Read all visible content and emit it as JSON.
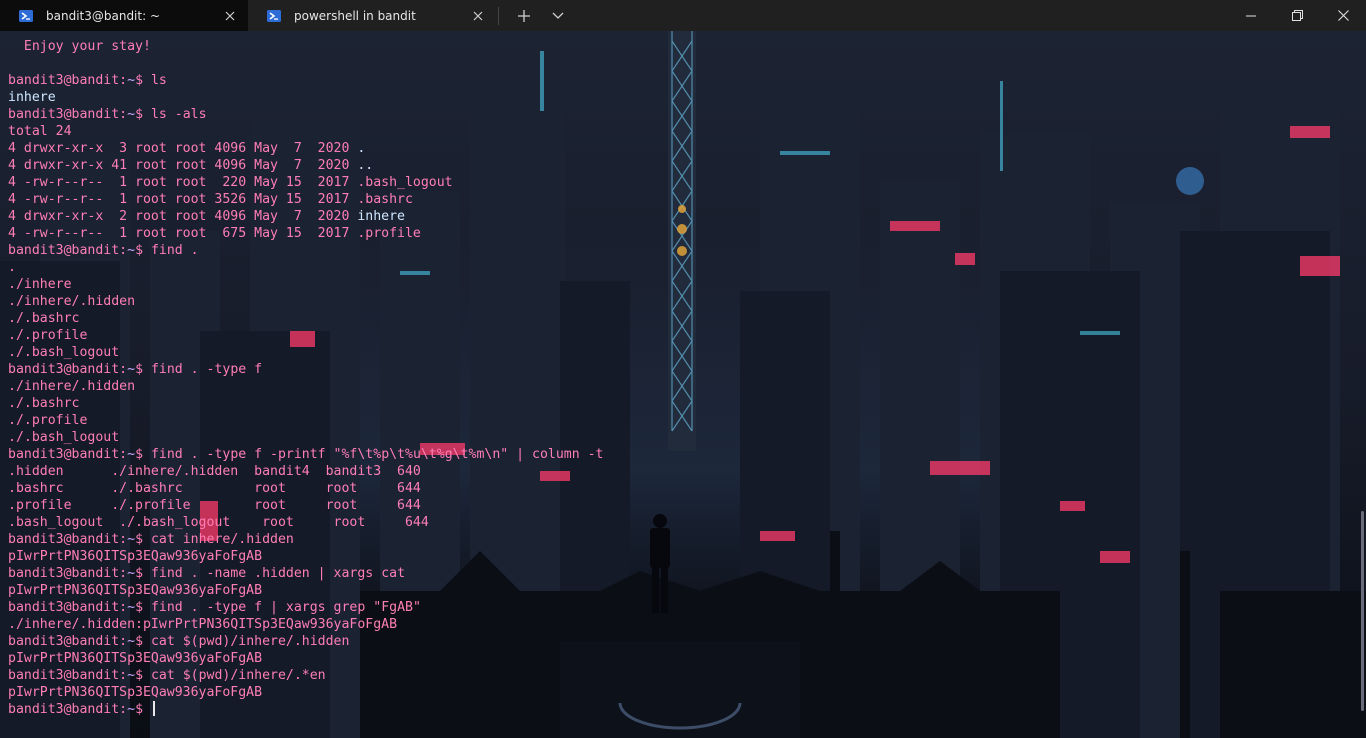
{
  "tabs": [
    {
      "title": "bandit3@bandit: ~",
      "icon": "powershell-icon",
      "active": true
    },
    {
      "title": "powershell in bandit",
      "icon": "powershell-icon",
      "active": false
    }
  ],
  "terminal": {
    "prompt_user": "bandit3@bandit",
    "prompt_path": "~",
    "lines": [
      {
        "segs": [
          {
            "t": "  Enjoy your stay!",
            "c": "out"
          }
        ]
      },
      {
        "segs": [
          {
            "t": "",
            "c": "out"
          }
        ]
      },
      {
        "segs": [
          {
            "t": "bandit3@bandit",
            "c": "prompt"
          },
          {
            "t": ":",
            "c": "colon"
          },
          {
            "t": "~",
            "c": "path"
          },
          {
            "t": "$ ls",
            "c": "prompt"
          }
        ]
      },
      {
        "segs": [
          {
            "t": "inhere",
            "c": "blue"
          }
        ]
      },
      {
        "segs": [
          {
            "t": "bandit3@bandit",
            "c": "prompt"
          },
          {
            "t": ":",
            "c": "colon"
          },
          {
            "t": "~",
            "c": "path"
          },
          {
            "t": "$ ls -als",
            "c": "prompt"
          }
        ]
      },
      {
        "segs": [
          {
            "t": "total 24",
            "c": "out"
          }
        ]
      },
      {
        "segs": [
          {
            "t": "4 drwxr-xr-x  3 root root 4096 May  7  2020 ",
            "c": "out"
          },
          {
            "t": ".",
            "c": "blue"
          }
        ]
      },
      {
        "segs": [
          {
            "t": "4 drwxr-xr-x 41 root root 4096 May  7  2020 ",
            "c": "out"
          },
          {
            "t": "..",
            "c": "blue"
          }
        ]
      },
      {
        "segs": [
          {
            "t": "4 -rw-r--r--  1 root root  220 May 15  2017 .bash_logout",
            "c": "out"
          }
        ]
      },
      {
        "segs": [
          {
            "t": "4 -rw-r--r--  1 root root 3526 May 15  2017 .bashrc",
            "c": "out"
          }
        ]
      },
      {
        "segs": [
          {
            "t": "4 drwxr-xr-x  2 root root 4096 May  7  2020 ",
            "c": "out"
          },
          {
            "t": "inhere",
            "c": "blue"
          }
        ]
      },
      {
        "segs": [
          {
            "t": "4 -rw-r--r--  1 root root  675 May 15  2017 .profile",
            "c": "out"
          }
        ]
      },
      {
        "segs": [
          {
            "t": "bandit3@bandit",
            "c": "prompt"
          },
          {
            "t": ":",
            "c": "colon"
          },
          {
            "t": "~",
            "c": "path"
          },
          {
            "t": "$ find .",
            "c": "prompt"
          }
        ]
      },
      {
        "segs": [
          {
            "t": ".",
            "c": "out"
          }
        ]
      },
      {
        "segs": [
          {
            "t": "./inhere",
            "c": "out"
          }
        ]
      },
      {
        "segs": [
          {
            "t": "./inhere/.hidden",
            "c": "out"
          }
        ]
      },
      {
        "segs": [
          {
            "t": "./.bashrc",
            "c": "out"
          }
        ]
      },
      {
        "segs": [
          {
            "t": "./.profile",
            "c": "out"
          }
        ]
      },
      {
        "segs": [
          {
            "t": "./.bash_logout",
            "c": "out"
          }
        ]
      },
      {
        "segs": [
          {
            "t": "bandit3@bandit",
            "c": "prompt"
          },
          {
            "t": ":",
            "c": "colon"
          },
          {
            "t": "~",
            "c": "path"
          },
          {
            "t": "$ find . -type f",
            "c": "prompt"
          }
        ]
      },
      {
        "segs": [
          {
            "t": "./inhere/.hidden",
            "c": "out"
          }
        ]
      },
      {
        "segs": [
          {
            "t": "./.bashrc",
            "c": "out"
          }
        ]
      },
      {
        "segs": [
          {
            "t": "./.profile",
            "c": "out"
          }
        ]
      },
      {
        "segs": [
          {
            "t": "./.bash_logout",
            "c": "out"
          }
        ]
      },
      {
        "segs": [
          {
            "t": "bandit3@bandit",
            "c": "prompt"
          },
          {
            "t": ":",
            "c": "colon"
          },
          {
            "t": "~",
            "c": "path"
          },
          {
            "t": "$ find . -type f -printf \"%f\\t%p\\t%u\\t%g\\t%m\\n\" | column -t",
            "c": "prompt"
          }
        ]
      },
      {
        "segs": [
          {
            "t": ".hidden      ./inhere/.hidden  bandit4  bandit3  640",
            "c": "out"
          }
        ]
      },
      {
        "segs": [
          {
            "t": ".bashrc      ./.bashrc         root     root     644",
            "c": "out"
          }
        ]
      },
      {
        "segs": [
          {
            "t": ".profile     ./.profile        root     root     644",
            "c": "out"
          }
        ]
      },
      {
        "segs": [
          {
            "t": ".bash_logout  ./.bash_logout    root     root     644",
            "c": "out"
          }
        ]
      },
      {
        "segs": [
          {
            "t": "bandit3@bandit",
            "c": "prompt"
          },
          {
            "t": ":",
            "c": "colon"
          },
          {
            "t": "~",
            "c": "path"
          },
          {
            "t": "$ cat inhere/.hidden",
            "c": "prompt"
          }
        ]
      },
      {
        "segs": [
          {
            "t": "pIwrPrtPN36QITSp3EQaw936yaFoFgAB",
            "c": "out"
          }
        ]
      },
      {
        "segs": [
          {
            "t": "bandit3@bandit",
            "c": "prompt"
          },
          {
            "t": ":",
            "c": "colon"
          },
          {
            "t": "~",
            "c": "path"
          },
          {
            "t": "$ find . -name .hidden | xargs cat",
            "c": "prompt"
          }
        ]
      },
      {
        "segs": [
          {
            "t": "pIwrPrtPN36QITSp3EQaw936yaFoFgAB",
            "c": "out"
          }
        ]
      },
      {
        "segs": [
          {
            "t": "bandit3@bandit",
            "c": "prompt"
          },
          {
            "t": ":",
            "c": "colon"
          },
          {
            "t": "~",
            "c": "path"
          },
          {
            "t": "$ find . -type f | xargs grep \"FgAB\"",
            "c": "prompt"
          }
        ]
      },
      {
        "segs": [
          {
            "t": "./inhere/.hidden:pIwrPrtPN36QITSp3EQaw936yaFoFgAB",
            "c": "out"
          }
        ]
      },
      {
        "segs": [
          {
            "t": "bandit3@bandit",
            "c": "prompt"
          },
          {
            "t": ":",
            "c": "colon"
          },
          {
            "t": "~",
            "c": "path"
          },
          {
            "t": "$ cat $(pwd)/inhere/.hidden",
            "c": "prompt"
          }
        ]
      },
      {
        "segs": [
          {
            "t": "pIwrPrtPN36QITSp3EQaw936yaFoFgAB",
            "c": "out"
          }
        ]
      },
      {
        "segs": [
          {
            "t": "bandit3@bandit",
            "c": "prompt"
          },
          {
            "t": ":",
            "c": "colon"
          },
          {
            "t": "~",
            "c": "path"
          },
          {
            "t": "$ cat $(pwd)/inhere/.*en",
            "c": "prompt"
          }
        ]
      },
      {
        "segs": [
          {
            "t": "pIwrPrtPN36QITSp3EQaw936yaFoFgAB",
            "c": "out"
          }
        ]
      },
      {
        "segs": [
          {
            "t": "bandit3@bandit",
            "c": "prompt"
          },
          {
            "t": ":",
            "c": "colon"
          },
          {
            "t": "~",
            "c": "path"
          },
          {
            "t": "$ ",
            "c": "prompt"
          }
        ],
        "cursor": true
      }
    ]
  },
  "colors": {
    "prompt": "#ff7eb6",
    "path": "#c9a7ff",
    "output": "#ff7eb6",
    "directory": "#cfe6ff",
    "tab_active_bg": "#0c0c0c",
    "titlebar_bg": "#202020"
  },
  "icons": {
    "new_tab": "plus-icon",
    "dropdown": "chevron-down-icon",
    "minimize": "minimize-icon",
    "maximize": "restore-icon",
    "close": "close-icon"
  }
}
